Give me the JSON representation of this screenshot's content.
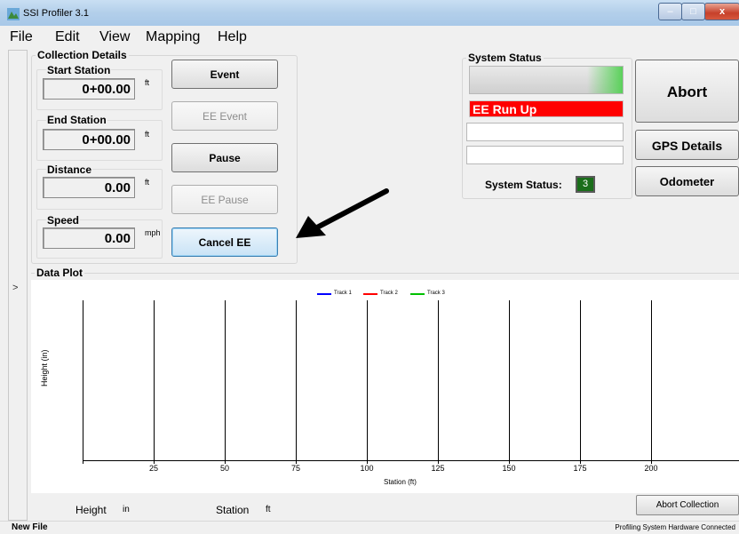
{
  "window": {
    "title": "SSI Profiler 3.1",
    "minimize": "–",
    "maximize": "□",
    "close": "x"
  },
  "menu": [
    {
      "label": "File"
    },
    {
      "label": "Edit"
    },
    {
      "label": "View"
    },
    {
      "label": "Mapping"
    },
    {
      "label": "Help"
    }
  ],
  "collection": {
    "title": "Collection Details",
    "start_station": {
      "label": "Start Station",
      "value": "0+00.00",
      "unit": "ft"
    },
    "end_station": {
      "label": "End Station",
      "value": "0+00.00",
      "unit": "ft"
    },
    "distance": {
      "label": "Distance",
      "value": "0.00",
      "unit": "ft"
    },
    "speed": {
      "label": "Speed",
      "value": "0.00",
      "unit": "mph"
    }
  },
  "buttons": {
    "event": "Event",
    "ee_event": "EE Event",
    "pause": "Pause",
    "ee_pause": "EE Pause",
    "cancel_ee": "Cancel EE"
  },
  "system_status": {
    "title": "System Status",
    "message": "EE Run Up",
    "message_color": "#ff0000",
    "label": "System Status:",
    "code": "3",
    "code_color": "#1a6e1a"
  },
  "right_buttons": {
    "abort": "Abort",
    "gps": "GPS Details",
    "odometer": "Odometer"
  },
  "plot": {
    "title": "Data Plot",
    "ylabel": "Height (in)",
    "xlabel": "Station (ft)",
    "legend": [
      {
        "name": "Track 1",
        "color": "#0000ff"
      },
      {
        "name": "Track 2",
        "color": "#ff0000"
      },
      {
        "name": "Track 3",
        "color": "#00c000"
      }
    ],
    "x_ticks": [
      "25",
      "50",
      "75",
      "100",
      "125",
      "150",
      "175",
      "200"
    ]
  },
  "readout": {
    "height_label": "Height",
    "height_unit": "in",
    "station_label": "Station",
    "station_unit": "ft",
    "abort_collection": "Abort Collection"
  },
  "statusbar": {
    "file": "New File",
    "hardware": "Profiling System Hardware Connected"
  },
  "strip": {
    "expand": ">"
  }
}
